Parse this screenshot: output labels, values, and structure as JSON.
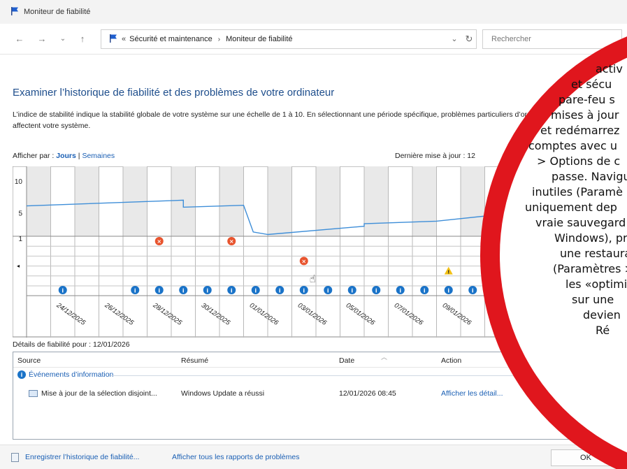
{
  "window": {
    "title": "Moniteur de fiabilité"
  },
  "address": {
    "prefix": "«",
    "crumbs": [
      "Sécurité et maintenance",
      "Moniteur de fiabilité"
    ],
    "search_placeholder": "Rechercher"
  },
  "main": {
    "heading": "Examiner l’historique de fiabilité et des problèmes de votre ordinateur",
    "description": "L’indice de stabilité indique la stabilité globale de votre système sur une échelle de 1 à 10. En sélectionnant une période spécifique, problèmes particuliers d’ordre matériel ou logiciel qui affectent votre système.",
    "view_by_label": "Afficher par :",
    "view_days": "Jours",
    "view_sep": "|",
    "view_weeks": "Semaines",
    "last_update": "Dernière mise à jour : 12"
  },
  "chart_data": {
    "type": "line",
    "y_ticks": [
      "10",
      "5",
      "1"
    ],
    "ylim": [
      1,
      10
    ],
    "dates": [
      "24/12/2025",
      "26/12/2025",
      "28/12/2025",
      "30/12/2025",
      "01/01/2026",
      "03/01/2026",
      "05/01/2026",
      "07/01/2026",
      "09/01/2026",
      "11/"
    ],
    "days": 23,
    "stability": [
      [
        0,
        6.1
      ],
      [
        6.5,
        7.0
      ],
      [
        6.5,
        5.9
      ],
      [
        9.0,
        6.2
      ],
      [
        9.4,
        2.0
      ],
      [
        10.0,
        1.6
      ],
      [
        14.0,
        2.9
      ],
      [
        14.0,
        3.3
      ],
      [
        17.0,
        3.7
      ],
      [
        20.0,
        4.9
      ],
      [
        20.3,
        5.2
      ],
      [
        20.5,
        7.0
      ],
      [
        20.7,
        5.1
      ],
      [
        23.0,
        5.7
      ]
    ],
    "critical_events": [
      {
        "day": 5,
        "row": 0
      },
      {
        "day": 8,
        "row": 0
      },
      {
        "day": 11,
        "row": 2
      },
      {
        "day": 19,
        "row": 0
      }
    ],
    "warning_events": [
      {
        "day": 17,
        "row": 3
      }
    ],
    "info_days": [
      1,
      4,
      5,
      6,
      7,
      8,
      9,
      10,
      11,
      12,
      13,
      14,
      15,
      16,
      17,
      18,
      19,
      20,
      21,
      22
    ]
  },
  "details": {
    "title": "Détails de fiabilité pour : 12/01/2026",
    "columns": {
      "source": "Source",
      "summary": "Résumé",
      "date": "Date",
      "action": "Action"
    },
    "group_label": "Événements d’information",
    "rows": [
      {
        "source": "Mise à jour de la sélection disjoint...",
        "summary": "Windows Update a réussi",
        "date": "12/01/2026 08:45",
        "action": "Afficher les détail..."
      }
    ]
  },
  "footer": {
    "save_label": "Enregistrer l’historique de fiabilité...",
    "reports_label": "Afficher tous les rapports de problèmes",
    "ok_label": "OK"
  },
  "overlay": {
    "color": "#e0161d",
    "lines": [
      "activ",
      "et sécu",
      "pare-feu s",
      "mises à jour",
      "et redémarrez",
      "comptes avec u",
      "> Options de c",
      "passe. Navigu",
      "inutiles (Paramè",
      "uniquement dep",
      "vraie sauvegard",
      "Windows), pro",
      "une restaura",
      "(Paramètres > .",
      "les «optimis",
      "sur une",
      "devien",
      "Ré"
    ]
  }
}
